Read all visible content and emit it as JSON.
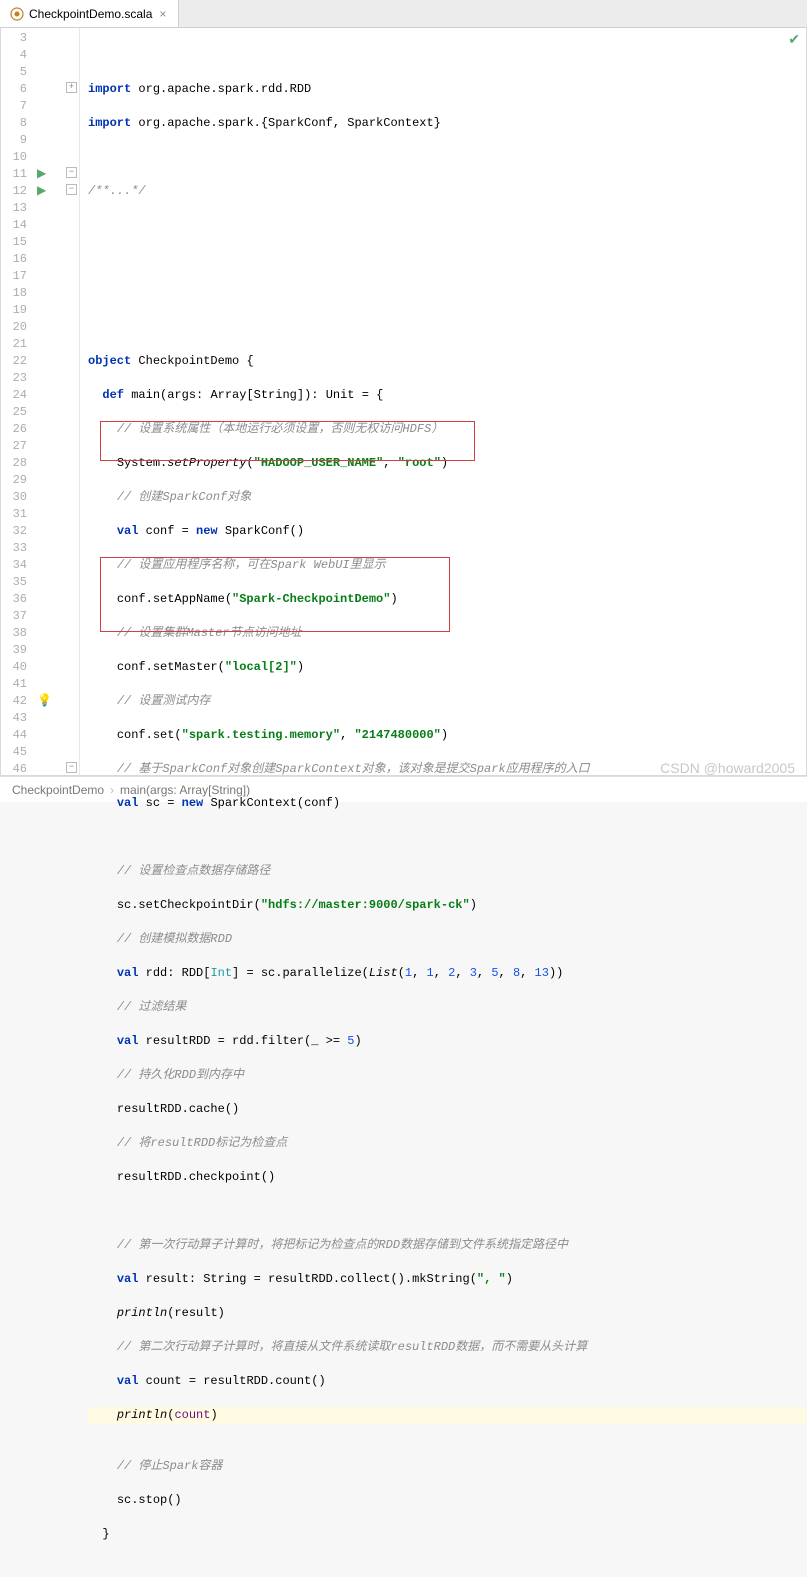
{
  "tab": {
    "title": "CheckpointDemo.scala"
  },
  "lines": {
    "start": 3,
    "end": 46,
    "highlight": 42
  },
  "code": {
    "l3": {
      "kw1": "import",
      "pkg": " org.apache.spark.rdd.RDD"
    },
    "l4": {
      "kw1": "import",
      "pkg": " org.apache.spark.{SparkConf, SparkContext}"
    },
    "l6": {
      "cmt": "/**...*/"
    },
    "l11": {
      "kw1": "object",
      "name": " CheckpointDemo {"
    },
    "l12": {
      "kw1": "def",
      "fn": "main",
      "sig1": "(args: Array[",
      "typ": "String",
      "sig2": "]): ",
      "ret": "Unit",
      "sig3": " = {"
    },
    "l13": {
      "cmt": "// 设置系统属性（本地运行必须设置，否则无权访问HDFS）"
    },
    "l14": {
      "pre": "System.",
      "fn": "setProperty",
      "open": "(",
      "s1": "\"HADOOP_USER_NAME\"",
      "sep": ", ",
      "s2": "\"root\"",
      "close": ")"
    },
    "l15": {
      "cmt": "// 创建SparkConf对象"
    },
    "l16": {
      "kw1": "val",
      "name": " conf = ",
      "kw2": "new",
      "rest": " SparkConf()"
    },
    "l17": {
      "cmt": "// 设置应用程序名称，可在Spark WebUI里显示"
    },
    "l18": {
      "pre": "conf.setAppName(",
      "s1": "\"Spark-CheckpointDemo\"",
      "close": ")"
    },
    "l19": {
      "cmt": "// 设置集群Master节点访问地址"
    },
    "l20": {
      "pre": "conf.setMaster(",
      "s1": "\"local[2]\"",
      "close": ")"
    },
    "l21": {
      "cmt": "// 设置测试内存"
    },
    "l22": {
      "pre": "conf.set(",
      "s1": "\"spark.testing.memory\"",
      "sep": ", ",
      "s2": "\"2147480000\"",
      "close": ")"
    },
    "l23": {
      "cmt": "// 基于SparkConf对象创建SparkContext对象，该对象是提交Spark应用程序的入口"
    },
    "l24": {
      "kw1": "val",
      "name": " sc = ",
      "kw2": "new",
      "rest": " SparkContext(conf)"
    },
    "l26": {
      "cmt": "// 设置检查点数据存储路径"
    },
    "l27": {
      "pre": "sc.setCheckpointDir(",
      "s1": "\"hdfs://master:9000/spark-ck\"",
      "close": ")"
    },
    "l28": {
      "cmt": "// 创建模拟数据RDD"
    },
    "l29": {
      "kw1": "val",
      "name": " rdd: RDD[",
      "typ": "Int",
      "mid": "] = sc.parallelize(",
      "fn": "List",
      "open": "(",
      "n1": "1",
      "c1": ", ",
      "n2": "1",
      "c2": ", ",
      "n3": "2",
      "c3": ", ",
      "n4": "3",
      "c4": ", ",
      "n5": "5",
      "c5": ", ",
      "n6": "8",
      "c6": ", ",
      "n7": "13",
      "close": "))"
    },
    "l30": {
      "cmt": "// 过滤结果"
    },
    "l31": {
      "kw1": "val",
      "name": " resultRDD = rdd.filter(_ >= ",
      "n1": "5",
      "close": ")"
    },
    "l32": {
      "cmt": "// 持久化RDD到内存中"
    },
    "l33": {
      "txt": "resultRDD.cache()"
    },
    "l34": {
      "cmt": "// 将resultRDD标记为检查点"
    },
    "l35": {
      "txt": "resultRDD.checkpoint()"
    },
    "l37": {
      "cmt": "// 第一次行动算子计算时，将把标记为检查点的RDD数据存储到文件系统指定路径中"
    },
    "l38": {
      "kw1": "val",
      "name": " result: ",
      "typ": "String",
      "rest": " = resultRDD.collect().mkString(",
      "s1": "\", \"",
      "close": ")"
    },
    "l39": {
      "fn": "println",
      "open": "(result)"
    },
    "l40": {
      "cmt": "// 第二次行动算子计算时，将直接从文件系统读取resultRDD数据，而不需要从头计算"
    },
    "l41": {
      "kw1": "val",
      "name": " count = resultRDD.count()"
    },
    "l42": {
      "fn": "println",
      "open": "(",
      "param": "count",
      "close": ")"
    },
    "l44": {
      "cmt": "// 停止Spark容器"
    },
    "l45": {
      "txt": "sc.stop()"
    },
    "l46": {
      "txt": "}"
    }
  },
  "breadcrumb": {
    "item1": "CheckpointDemo",
    "item2": "main(args: Array[String])"
  },
  "watermark": "CSDN @howard2005"
}
